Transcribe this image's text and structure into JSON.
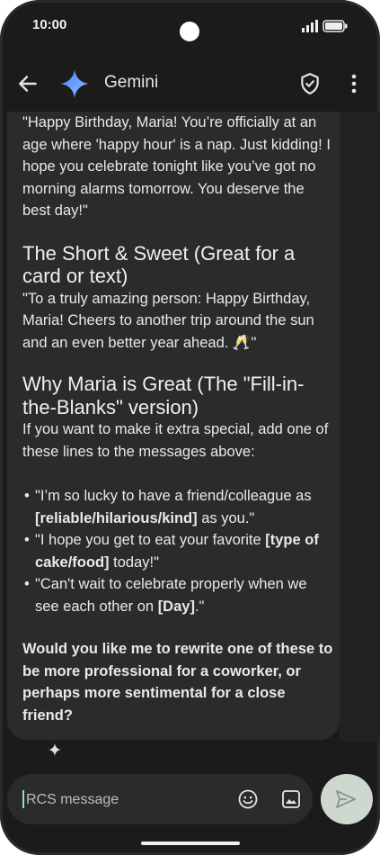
{
  "status": {
    "time": "10:00"
  },
  "header": {
    "title": "Gemini"
  },
  "message": {
    "intro": "\"Happy Birthday, Maria! You’re officially at an age where 'happy hour' is a nap. Just kidding! I hope you celebrate tonight like you’ve got no morning alarms tomorrow. You deserve the best day!\"",
    "section1_heading": "The Short & Sweet (Great for a card or text)",
    "section1_text": "\"To a truly amazing person: Happy Birthday, Maria! Cheers to another trip around the sun and an even better year ahead. 🥂\"",
    "section2_heading": "Why Maria is Great (The \"Fill-in-the-Blanks\" version)",
    "section2_intro": "If you want to make it extra special, add one of these lines to the messages above:",
    "bullets": [
      {
        "a": "\"I’m so lucky to have a friend/colleague as ",
        "b": "[reliable/hilarious/kind]",
        "c": " as you.\""
      },
      {
        "a": "\"I hope you get to eat your favorite ",
        "b": "[type of cake/food]",
        "c": " today!\""
      },
      {
        "a": "\"Can't wait to celebrate properly when we see each other on ",
        "b": "[Day]",
        "c": ".\""
      }
    ],
    "closing_question": "Would you like me to rewrite one of these to be more professional for a coworker, or perhaps more sentimental for a close friend?"
  },
  "composer": {
    "placeholder": "RCS message"
  },
  "icons": {
    "back": "arrow-left-icon",
    "logo": "gemini-sparkle-icon",
    "shield": "shield-check-icon",
    "more": "more-vert-icon",
    "emoji": "emoji-icon",
    "gallery": "image-icon",
    "send": "send-icon"
  },
  "colors": {
    "background": "#1b1b1b",
    "card": "#2b2b2b",
    "send_button": "#cfd8cf"
  }
}
